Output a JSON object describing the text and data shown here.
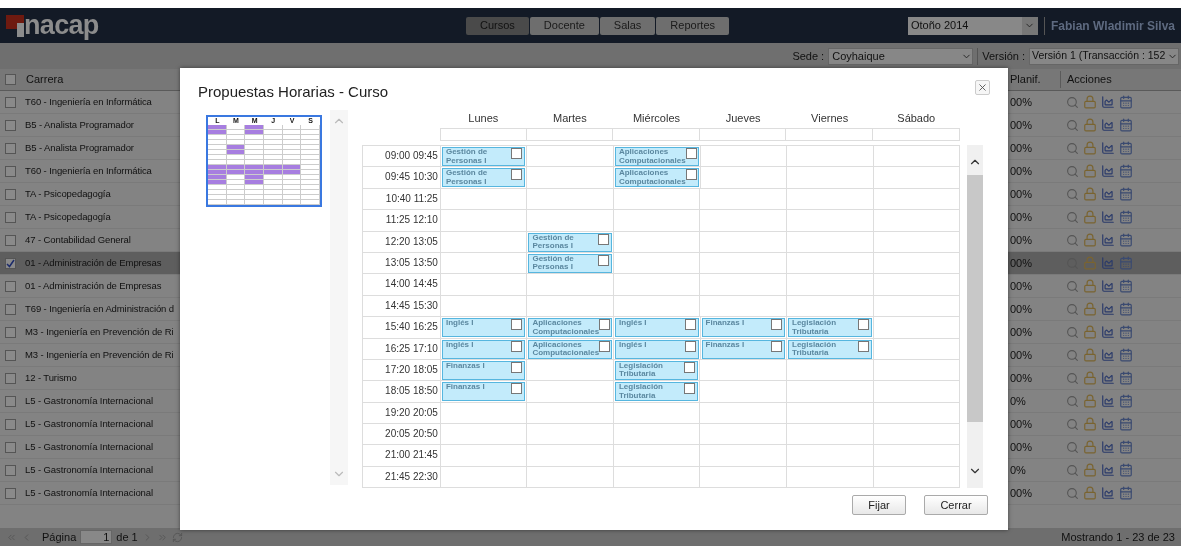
{
  "header": {
    "logo_text": "nacap",
    "nav": [
      {
        "label": "Cursos",
        "selected": true
      },
      {
        "label": "Docente",
        "selected": false
      },
      {
        "label": "Salas",
        "selected": false
      },
      {
        "label": "Reportes",
        "selected": false
      }
    ],
    "term": "Otoño 2014",
    "user": "Fabian Wladimir Silva"
  },
  "toolbar": {
    "sede_label": "Sede :",
    "sede": "Coyhaique",
    "version_label": "Versión :",
    "version": "Versión 1 (Transacción : 152"
  },
  "table": {
    "columns": [
      "Carrera",
      "Planif.",
      "Acciones"
    ],
    "all_checked": false,
    "rows": [
      {
        "carrera": "T60 - Ingeniería en Informática",
        "planif": "00%",
        "checked": false,
        "selected": false
      },
      {
        "carrera": "B5 - Analista Programador",
        "planif": "00%",
        "checked": false,
        "selected": false
      },
      {
        "carrera": "B5 - Analista Programador",
        "planif": "00%",
        "checked": false,
        "selected": false
      },
      {
        "carrera": "T60 - Ingeniería en Informática",
        "planif": "00%",
        "checked": false,
        "selected": false
      },
      {
        "carrera": "TA - Psicopedagogía",
        "planif": "00%",
        "checked": false,
        "selected": false
      },
      {
        "carrera": "TA - Psicopedagogía",
        "planif": "00%",
        "checked": false,
        "selected": false
      },
      {
        "carrera": "47 - Contabilidad General",
        "planif": "00%",
        "checked": false,
        "selected": false
      },
      {
        "carrera": "01 - Administración de Empresas",
        "planif": "00%",
        "checked": true,
        "selected": true
      },
      {
        "carrera": "01 - Administración de Empresas",
        "planif": "00%",
        "checked": false,
        "selected": false
      },
      {
        "carrera": "T69 - Ingeniería en Administración d",
        "planif": "00%",
        "checked": false,
        "selected": false
      },
      {
        "carrera": "M3 - Ingeniería en Prevención de Ri",
        "planif": "00%",
        "checked": false,
        "selected": false
      },
      {
        "carrera": "M3 - Ingeniería en Prevención de Ri",
        "planif": "00%",
        "checked": false,
        "selected": false
      },
      {
        "carrera": "12 - Turismo",
        "planif": "00%",
        "checked": false,
        "selected": false
      },
      {
        "carrera": "L5 - Gastronomía Internacional",
        "planif": "0%",
        "checked": false,
        "selected": false
      },
      {
        "carrera": "L5 - Gastronomía Internacional",
        "planif": "00%",
        "checked": false,
        "selected": false
      },
      {
        "carrera": "L5 - Gastronomía Internacional",
        "planif": "00%",
        "checked": false,
        "selected": false
      },
      {
        "carrera": "L5 - Gastronomía Internacional",
        "planif": "0%",
        "checked": false,
        "selected": false
      },
      {
        "carrera": "L5 - Gastronomía Internacional",
        "planif": "00%",
        "checked": false,
        "selected": false
      }
    ]
  },
  "footer": {
    "page_label": "Página",
    "page": "1",
    "page_of": "de 1",
    "summary": "Mostrando 1 - 23 de 23"
  },
  "dialog": {
    "title": "Propuestas Horarias - Curso",
    "mini_days": [
      "L",
      "M",
      "M",
      "J",
      "V",
      "S"
    ],
    "days": [
      "Lunes",
      "Martes",
      "Miércoles",
      "Jueves",
      "Viernes",
      "Sábado"
    ],
    "slots": [
      {
        "time": "09:00 09:45",
        "cells": [
          {
            "kind": "course",
            "course": "Gestión de Personas I",
            "checked": false
          },
          {
            "kind": "empty"
          },
          {
            "kind": "course",
            "course": "Aplicaciones Computacionales",
            "checked": false
          },
          {
            "kind": "empty"
          },
          {
            "kind": "empty"
          },
          {
            "kind": "empty"
          }
        ]
      },
      {
        "time": "09:45 10:30",
        "cells": [
          {
            "kind": "course",
            "course": "Gestión de Personas I",
            "checked": false
          },
          {
            "kind": "empty"
          },
          {
            "kind": "course",
            "course": "Aplicaciones Computacionales",
            "checked": false
          },
          {
            "kind": "empty"
          },
          {
            "kind": "empty"
          },
          {
            "kind": "empty"
          }
        ]
      },
      {
        "time": "10:40 11:25",
        "cells": [
          {
            "kind": "empty"
          },
          {
            "kind": "empty"
          },
          {
            "kind": "empty"
          },
          {
            "kind": "empty"
          },
          {
            "kind": "empty"
          },
          {
            "kind": "empty"
          }
        ]
      },
      {
        "time": "11:25 12:10",
        "cells": [
          {
            "kind": "empty"
          },
          {
            "kind": "empty"
          },
          {
            "kind": "empty"
          },
          {
            "kind": "empty"
          },
          {
            "kind": "empty"
          },
          {
            "kind": "empty"
          }
        ]
      },
      {
        "time": "12:20 13:05",
        "cells": [
          {
            "kind": "empty"
          },
          {
            "kind": "course",
            "course": "Gestión de Personas I",
            "checked": false
          },
          {
            "kind": "empty"
          },
          {
            "kind": "empty"
          },
          {
            "kind": "empty"
          },
          {
            "kind": "empty"
          }
        ]
      },
      {
        "time": "13:05 13:50",
        "cells": [
          {
            "kind": "empty"
          },
          {
            "kind": "course",
            "course": "Gestión de Personas I",
            "checked": false
          },
          {
            "kind": "empty"
          },
          {
            "kind": "empty"
          },
          {
            "kind": "empty"
          },
          {
            "kind": "empty"
          }
        ]
      },
      {
        "time": "14:00 14:45",
        "cells": [
          {
            "kind": "empty"
          },
          {
            "kind": "empty"
          },
          {
            "kind": "empty"
          },
          {
            "kind": "empty"
          },
          {
            "kind": "empty"
          },
          {
            "kind": "empty"
          }
        ]
      },
      {
        "time": "14:45 15:30",
        "cells": [
          {
            "kind": "empty"
          },
          {
            "kind": "empty"
          },
          {
            "kind": "empty"
          },
          {
            "kind": "empty"
          },
          {
            "kind": "empty"
          },
          {
            "kind": "empty"
          }
        ]
      },
      {
        "time": "15:40 16:25",
        "cells": [
          {
            "kind": "course",
            "course": "Inglés I",
            "checked": false
          },
          {
            "kind": "course",
            "course": "Aplicaciones Computacionales",
            "checked": false
          },
          {
            "kind": "course",
            "course": "Inglés I",
            "checked": false
          },
          {
            "kind": "course",
            "course": "Finanzas I",
            "checked": false
          },
          {
            "kind": "course",
            "course": "Legislación Tributaria",
            "checked": false
          },
          {
            "kind": "empty"
          }
        ]
      },
      {
        "time": "16:25 17:10",
        "cells": [
          {
            "kind": "course",
            "course": "Inglés I",
            "checked": false
          },
          {
            "kind": "course",
            "course": "Aplicaciones Computacionales",
            "checked": false
          },
          {
            "kind": "course",
            "course": "Inglés I",
            "checked": false
          },
          {
            "kind": "course",
            "course": "Finanzas I",
            "checked": false
          },
          {
            "kind": "course",
            "course": "Legislación Tributaria",
            "checked": false
          },
          {
            "kind": "empty"
          }
        ]
      },
      {
        "time": "17:20 18:05",
        "cells": [
          {
            "kind": "course",
            "course": "Finanzas I",
            "checked": false
          },
          {
            "kind": "empty"
          },
          {
            "kind": "course",
            "course": "Legislación Tributaria",
            "checked": false
          },
          {
            "kind": "empty"
          },
          {
            "kind": "empty"
          },
          {
            "kind": "empty"
          }
        ]
      },
      {
        "time": "18:05 18:50",
        "cells": [
          {
            "kind": "course",
            "course": "Finanzas I",
            "checked": false
          },
          {
            "kind": "empty"
          },
          {
            "kind": "course",
            "course": "Legislación Tributaria",
            "checked": false
          },
          {
            "kind": "empty"
          },
          {
            "kind": "empty"
          },
          {
            "kind": "empty"
          }
        ]
      },
      {
        "time": "19:20 20:05",
        "cells": [
          {
            "kind": "empty"
          },
          {
            "kind": "empty"
          },
          {
            "kind": "empty"
          },
          {
            "kind": "empty"
          },
          {
            "kind": "empty"
          },
          {
            "kind": "empty"
          }
        ]
      },
      {
        "time": "20:05 20:50",
        "cells": [
          {
            "kind": "empty"
          },
          {
            "kind": "empty"
          },
          {
            "kind": "empty"
          },
          {
            "kind": "empty"
          },
          {
            "kind": "empty"
          },
          {
            "kind": "empty"
          }
        ]
      },
      {
        "time": "21:00 21:45",
        "cells": [
          {
            "kind": "empty"
          },
          {
            "kind": "empty"
          },
          {
            "kind": "empty"
          },
          {
            "kind": "empty"
          },
          {
            "kind": "empty"
          },
          {
            "kind": "empty"
          }
        ]
      },
      {
        "time": "21:45 22:30",
        "cells": [
          {
            "kind": "empty"
          },
          {
            "kind": "empty"
          },
          {
            "kind": "empty"
          },
          {
            "kind": "empty"
          },
          {
            "kind": "empty"
          },
          {
            "kind": "empty"
          }
        ]
      }
    ],
    "buttons": [
      "Fijar",
      "Cerrar"
    ]
  }
}
